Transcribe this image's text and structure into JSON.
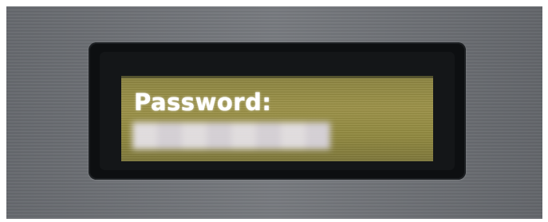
{
  "display": {
    "prompt_label": "Password:",
    "masked_input_blocks": 8,
    "screen_color": "#9a9046",
    "text_color": "#ffffff"
  }
}
